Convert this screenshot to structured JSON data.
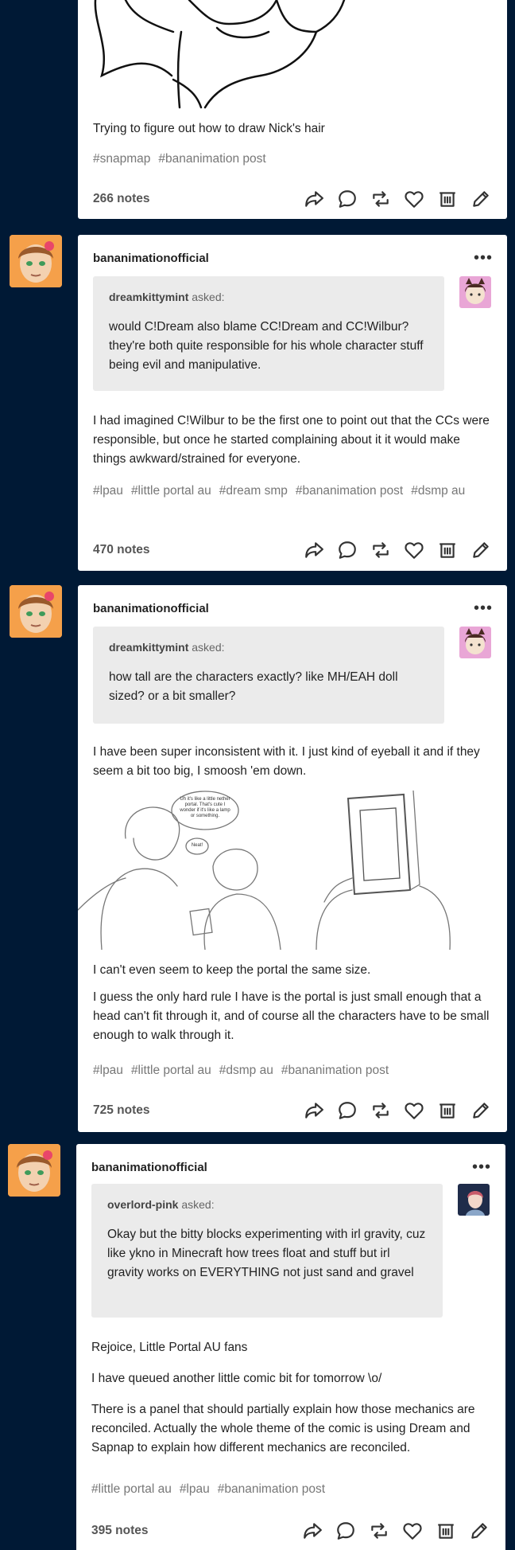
{
  "posts": [
    {
      "text": [
        "Trying to figure out how to draw Nick's hair"
      ],
      "tags": [
        "#snapmap",
        "#bananimation post"
      ],
      "notes": "266 notes"
    },
    {
      "blog": "bananimationofficial",
      "asker": "dreamkittymint",
      "asked_label": "asked:",
      "question": "would C!Dream also blame CC!Dream and CC!Wilbur? they're both quite responsible for his whole character stuff being evil and manipulative.",
      "text": [
        "I had imagined C!Wilbur to be the first one to point out that the CCs were responsible, but once he started complaining about it it would make things awkward/strained for everyone."
      ],
      "tags": [
        "#lpau",
        "#little portal au",
        "#dream smp",
        "#bananimation post",
        "#dsmp au"
      ],
      "notes": "470 notes"
    },
    {
      "blog": "bananimationofficial",
      "asker": "dreamkittymint",
      "asked_label": "asked:",
      "question": "how tall are the characters exactly? like MH/EAH doll sized? or a bit smaller?",
      "text": [
        "I have been super inconsistent with it. I just kind of eyeball it and if they seem a bit too big, I smoosh 'em down.",
        "I can't even seem to keep the portal the same size.",
        "I guess the only hard rule I have is the portal is just small enough that a head can't fit through it, and of course all the characters have to be small enough to walk through it."
      ],
      "comic_bubble_1": "Uh it's like a little nether portal. That's cute I wonder if it's like a lamp or something.",
      "comic_bubble_2": "Neat!",
      "tags": [
        "#lpau",
        "#little portal au",
        "#dsmp au",
        "#bananimation post"
      ],
      "notes": "725 notes"
    },
    {
      "blog": "bananimationofficial",
      "asker": "overlord-pink",
      "asked_label": "asked:",
      "question": "Okay but the bitty blocks experimenting with irl gravity, cuz like ykno in Minecraft how trees float and stuff but irl gravity works on EVERYTHING not just sand and gravel",
      "text": [
        "Rejoice, Little Portal AU fans",
        "I have queued another little comic bit for tomorrow \\o/",
        "There is a panel that should partially explain how those mechanics are reconciled. Actually the whole theme of the comic is using Dream and Sapnap to explain how different mechanics are reconciled."
      ],
      "tags": [
        "#little portal au",
        "#lpau",
        "#bananimation post"
      ],
      "notes": "395 notes"
    }
  ],
  "more_label": "•••",
  "action_icons": [
    "share-icon",
    "reply-icon",
    "reblog-icon",
    "like-icon",
    "delete-icon",
    "edit-icon"
  ]
}
